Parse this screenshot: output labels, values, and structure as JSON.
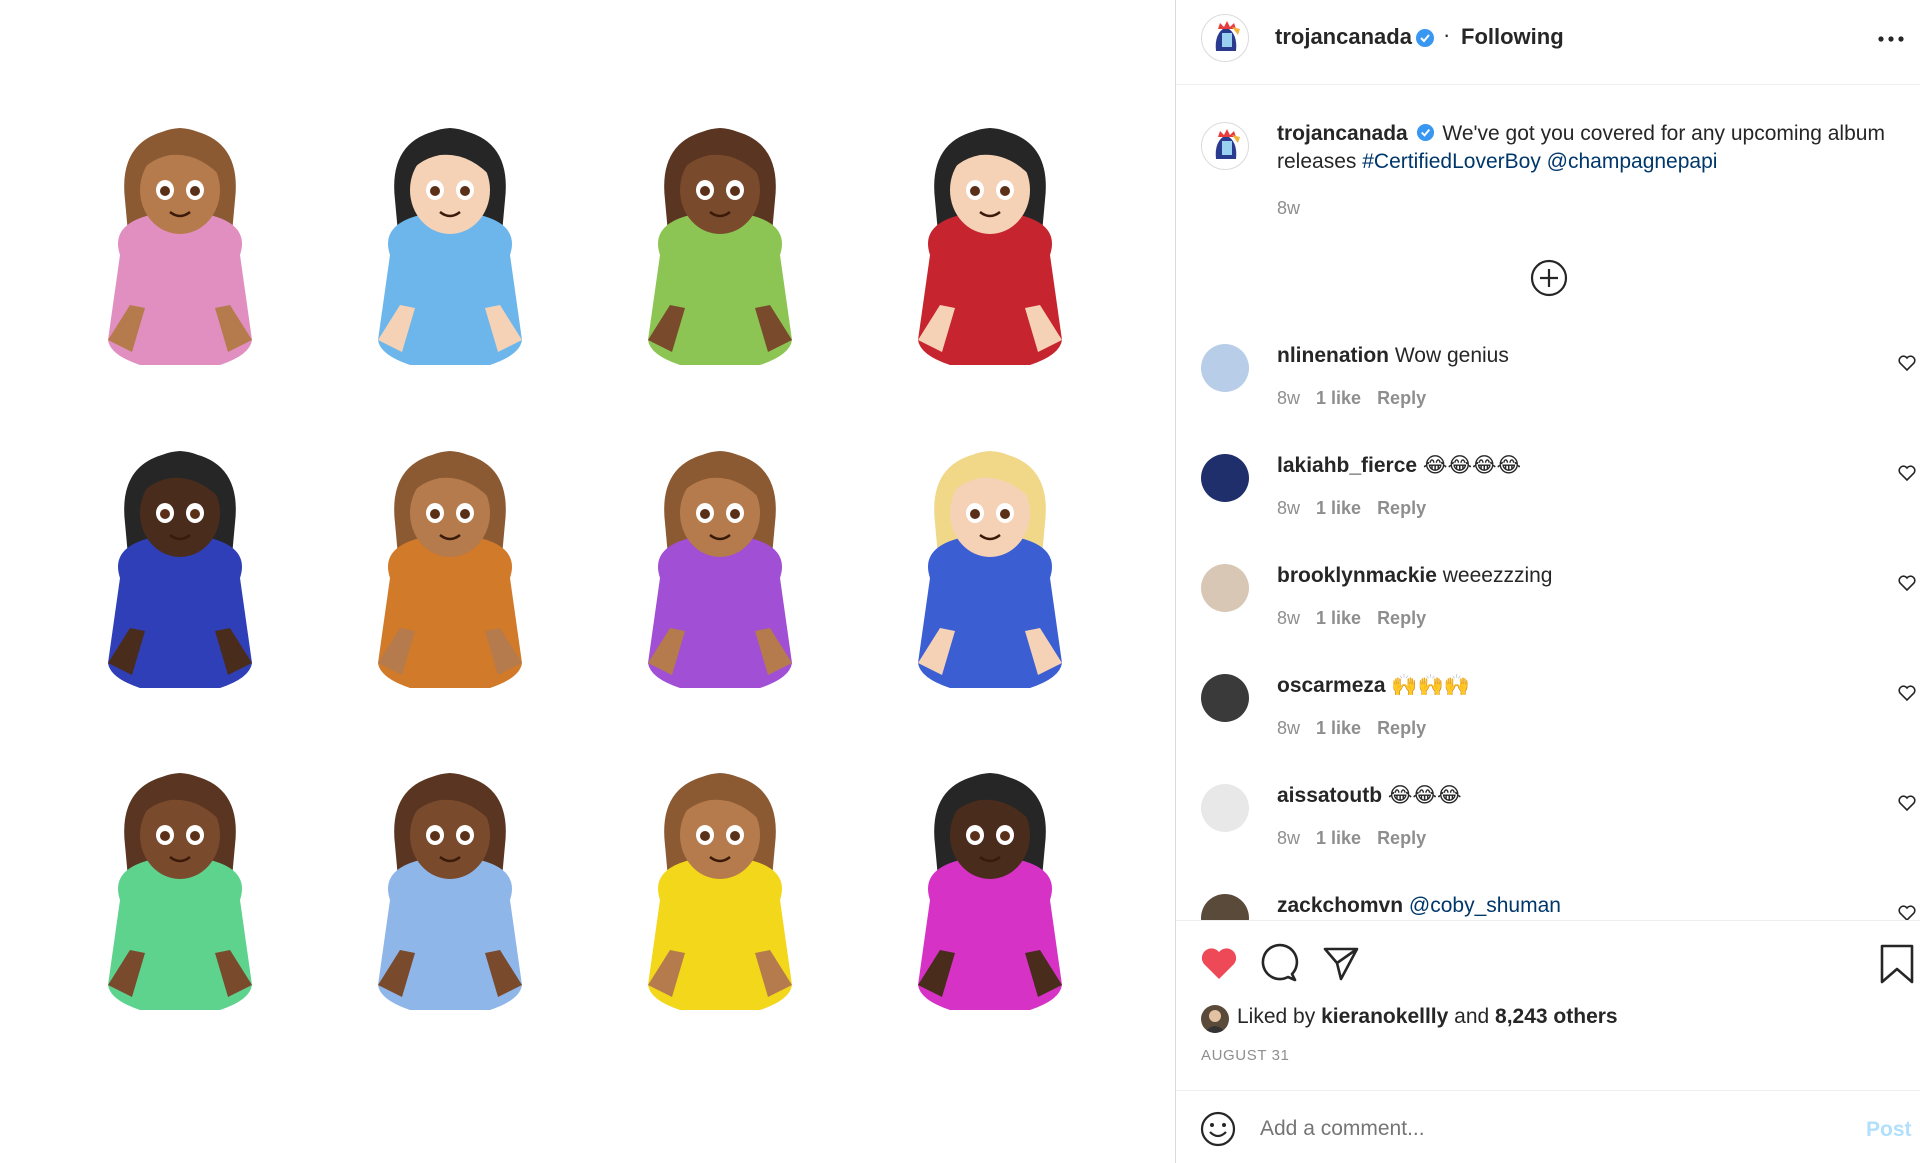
{
  "post": {
    "author": "trojancanada",
    "follow_sep": "·",
    "follow_state": "Following",
    "caption_text": "We've got you covered for any upcoming album",
    "caption_line2_prefix": "releases",
    "hashtag": "#CertifiedLoverBoy",
    "mention": "@champagnepapi",
    "caption_time": "8w"
  },
  "image": {
    "emojis": [
      {
        "skin": "#b57b4c",
        "hair": "#8b5a32",
        "shirt": "#e08fc0"
      },
      {
        "skin": "#f5d2b5",
        "hair": "#262626",
        "shirt": "#6db6ec"
      },
      {
        "skin": "#7a4a2c",
        "hair": "#5a3521",
        "shirt": "#8cc553"
      },
      {
        "skin": "#f5d2b5",
        "hair": "#262626",
        "shirt": "#c6242f"
      },
      {
        "skin": "#4a2c1c",
        "hair": "#262626",
        "shirt": "#2f3fb7"
      },
      {
        "skin": "#b57b4c",
        "hair": "#8b5a32",
        "shirt": "#d07a2a"
      },
      {
        "skin": "#b57b4c",
        "hair": "#8b5a32",
        "shirt": "#a14fd4"
      },
      {
        "skin": "#f5d2b5",
        "hair": "#f0d888",
        "shirt": "#3b5ed3"
      },
      {
        "skin": "#7a4a2c",
        "hair": "#5a3521",
        "shirt": "#5ed38e"
      },
      {
        "skin": "#7a4a2c",
        "hair": "#5a3521",
        "shirt": "#8fb6e8"
      },
      {
        "skin": "#b57b4c",
        "hair": "#8b5a32",
        "shirt": "#f3d71a"
      },
      {
        "skin": "#4a2c1c",
        "hair": "#262626",
        "shirt": "#d633c6"
      }
    ]
  },
  "comments": [
    {
      "user": "nlinenation",
      "text": "Wow genius",
      "time": "8w",
      "likes": "1 like",
      "reply": "Reply",
      "avatar": "#b7cde8"
    },
    {
      "user": "lakiahb_fierce",
      "text": "😂😂😂😂",
      "time": "8w",
      "likes": "1 like",
      "reply": "Reply",
      "avatar": "#1f2f6b"
    },
    {
      "user": "brooklynmackie",
      "text": "weeezzzing",
      "time": "8w",
      "likes": "1 like",
      "reply": "Reply",
      "avatar": "#d9c7b6"
    },
    {
      "user": "oscarmeza",
      "text": "🙌🙌🙌",
      "time": "8w",
      "likes": "1 like",
      "reply": "Reply",
      "avatar": "#3a3a3a"
    },
    {
      "user": "aissatoutb",
      "text": "😂😂😂",
      "time": "8w",
      "likes": "1 like",
      "reply": "Reply",
      "avatar": "#e8e8e8"
    },
    {
      "user": "zackchomvn",
      "text": "@coby_shuman",
      "time": "",
      "likes": "",
      "reply": "",
      "avatar": "#5a4a3a"
    }
  ],
  "actions": {
    "liked_prefix": "Liked by",
    "liked_user": "kieranokellly",
    "liked_and": "and",
    "liked_others": "8,243 others",
    "date": "AUGUST 31"
  },
  "add_comment": {
    "placeholder": "Add a comment...",
    "post_label": "Post"
  },
  "colors": {
    "accent_blue": "#0095f6",
    "heart_red": "#ed4956",
    "verified_blue": "#3897f0",
    "link": "#00376b"
  }
}
